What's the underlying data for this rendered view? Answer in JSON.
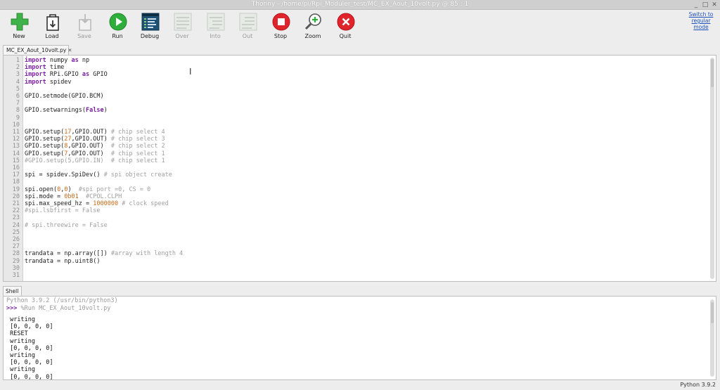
{
  "window": {
    "title": "Thonny  -  /home/pi/Rpi_Moduler_test/MC_EX_Aout_10volt.py  @  85 : 1",
    "minimize": "_",
    "maximize": "□",
    "close": "✕"
  },
  "toolbar": {
    "buttons": [
      {
        "id": "new",
        "label": "New",
        "icon": "plus-icon",
        "enabled": true
      },
      {
        "id": "load",
        "label": "Load",
        "icon": "folder-icon",
        "enabled": true
      },
      {
        "id": "save",
        "label": "Save",
        "icon": "save-icon",
        "enabled": false
      },
      {
        "id": "run",
        "label": "Run",
        "icon": "play-icon",
        "enabled": true
      },
      {
        "id": "debug",
        "label": "Debug",
        "icon": "debug-icon",
        "enabled": true
      },
      {
        "id": "over",
        "label": "Over",
        "icon": "step-over-icon",
        "enabled": false
      },
      {
        "id": "into",
        "label": "Into",
        "icon": "step-into-icon",
        "enabled": false
      },
      {
        "id": "out",
        "label": "Out",
        "icon": "step-out-icon",
        "enabled": false
      },
      {
        "id": "stop",
        "label": "Stop",
        "icon": "stop-icon",
        "enabled": true
      },
      {
        "id": "zoom",
        "label": "Zoom",
        "icon": "zoom-icon",
        "enabled": true
      },
      {
        "id": "quit",
        "label": "Quit",
        "icon": "quit-icon",
        "enabled": true
      }
    ],
    "switch_mode": "Switch to regular mode"
  },
  "editor": {
    "tab_label": "MC_EX_Aout_10volt.py",
    "tab_close": "✕",
    "line_numbers": [
      "1",
      "2",
      "3",
      "4",
      "5",
      "6",
      "7",
      "8",
      "9",
      "10",
      "11",
      "12",
      "13",
      "14",
      "15",
      "16",
      "17",
      "18",
      "19",
      "20",
      "21",
      "22",
      "23",
      "24",
      "25",
      "26",
      "27",
      "28",
      "29",
      "30",
      "31"
    ],
    "lines": [
      [
        {
          "t": "import",
          "c": "kw"
        },
        {
          "t": " numpy "
        },
        {
          "t": "as",
          "c": "kw"
        },
        {
          "t": " np"
        }
      ],
      [
        {
          "t": "import",
          "c": "kw"
        },
        {
          "t": " time"
        }
      ],
      [
        {
          "t": "import",
          "c": "kw"
        },
        {
          "t": " RPi.GPIO "
        },
        {
          "t": "as",
          "c": "kw"
        },
        {
          "t": " GPIO"
        }
      ],
      [
        {
          "t": "import",
          "c": "kw"
        },
        {
          "t": " spidev"
        }
      ],
      [],
      [
        {
          "t": "GPIO.setmode(GPIO.BCM)"
        }
      ],
      [],
      [
        {
          "t": "GPIO.setwarnings("
        },
        {
          "t": "False",
          "c": "bool"
        },
        {
          "t": ")"
        }
      ],
      [],
      [],
      [
        {
          "t": "GPIO.setup("
        },
        {
          "t": "17",
          "c": "num"
        },
        {
          "t": ",GPIO.OUT) "
        },
        {
          "t": "# chip select 4",
          "c": "cm"
        }
      ],
      [
        {
          "t": "GPIO.setup("
        },
        {
          "t": "27",
          "c": "num"
        },
        {
          "t": ",GPIO.OUT) "
        },
        {
          "t": "# chip select 3",
          "c": "cm"
        }
      ],
      [
        {
          "t": "GPIO.setup("
        },
        {
          "t": "8",
          "c": "num"
        },
        {
          "t": ",GPIO.OUT)  "
        },
        {
          "t": "# chip select 2",
          "c": "cm"
        }
      ],
      [
        {
          "t": "GPIO.setup("
        },
        {
          "t": "7",
          "c": "num"
        },
        {
          "t": ",GPIO.OUT)  "
        },
        {
          "t": "# chip select 1",
          "c": "cm"
        }
      ],
      [
        {
          "t": "#GPIO.setup(5,GPIO.IN)  # chip select 1",
          "c": "cm"
        }
      ],
      [],
      [
        {
          "t": "spi = spidev.SpiDev() "
        },
        {
          "t": "# spi object create",
          "c": "cm"
        }
      ],
      [],
      [
        {
          "t": "spi.open("
        },
        {
          "t": "0",
          "c": "num"
        },
        {
          "t": ","
        },
        {
          "t": "0",
          "c": "num"
        },
        {
          "t": ")  "
        },
        {
          "t": "#spi port =0, CS = 0",
          "c": "cm"
        }
      ],
      [
        {
          "t": "spi.mode = "
        },
        {
          "t": "0b01",
          "c": "num"
        },
        {
          "t": "  "
        },
        {
          "t": "#CPOL.CLPH",
          "c": "cm"
        }
      ],
      [
        {
          "t": "spi.max_speed_hz = "
        },
        {
          "t": "1000000",
          "c": "num"
        },
        {
          "t": " "
        },
        {
          "t": "# clock speed",
          "c": "cm"
        }
      ],
      [
        {
          "t": "#spi.lsbfirst = False",
          "c": "cm"
        }
      ],
      [],
      [
        {
          "t": "# spi.threewire = False",
          "c": "cm"
        }
      ],
      [],
      [],
      [],
      [
        {
          "t": "trandata = np.array([]) "
        },
        {
          "t": "#array with length 4",
          "c": "cm"
        }
      ],
      [
        {
          "t": "trandata = np.uint8()"
        }
      ],
      [],
      []
    ]
  },
  "shell": {
    "tab_label": "Shell",
    "banner": "Python 3.9.2 (/usr/bin/python3)",
    "prompt": ">>>",
    "command": " %Run MC_EX_Aout_10volt.py",
    "output": [
      " writing",
      " [0, 0, 0, 0]",
      " RESET",
      " writing",
      " [0, 0, 0, 0]",
      " writing",
      " [0, 0, 0, 0]",
      " writing",
      " [0, 0, 0, 0]"
    ]
  },
  "status": {
    "interpreter": "Python 3.9.2"
  },
  "colors": {
    "keyword": "#7a1fa2",
    "comment": "#a0a0a0",
    "number": "#c76a1b",
    "run_green": "#2fae3c",
    "stop_red": "#e0242b",
    "link_blue": "#1a4fbd"
  }
}
